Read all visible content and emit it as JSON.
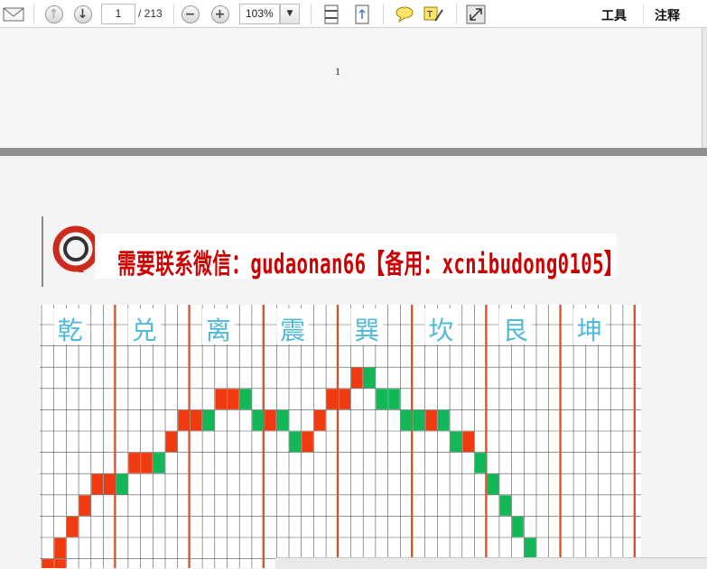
{
  "toolbar": {
    "page_current": "1",
    "page_total": "/ 213",
    "zoom": "103%",
    "tools_label": "工具",
    "comment_label": "注释"
  },
  "page1": {
    "page_number": "1"
  },
  "page2": {
    "banner": "需要联系微信：gudaonan66【备用：xcnibudong0105】",
    "trigram_labels": [
      "乾",
      "兑",
      "离",
      "震",
      "巽",
      "坎",
      "艮",
      "坤"
    ]
  },
  "colors": {
    "accent_red": "#cc0000",
    "trigram_label": "#4fb9d8",
    "up_cell": "#f03a10",
    "down_cell": "#12b858",
    "divider_line": "#e2502a"
  },
  "icons": [
    "mail-icon",
    "arrow-up-icon",
    "arrow-down-icon",
    "zoom-out-icon",
    "zoom-in-icon",
    "page-fit-icon",
    "page-rotate-icon",
    "comment-bubble-icon",
    "highlight-note-icon",
    "fullscreen-icon",
    "logo-icon"
  ]
}
